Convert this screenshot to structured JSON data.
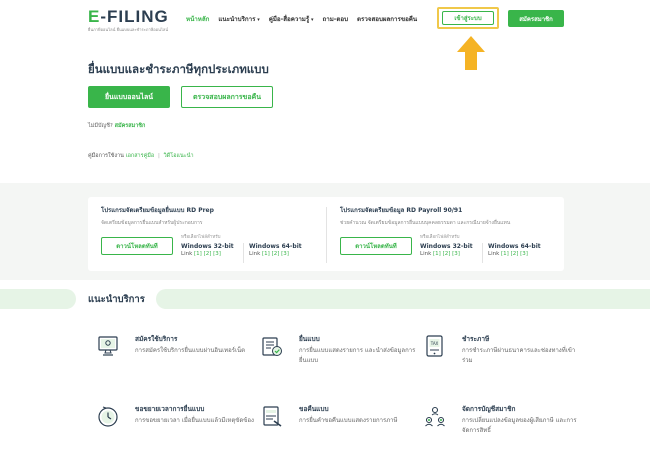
{
  "header": {
    "logo_text": "-FILING",
    "logo_letter": "E",
    "logo_subtitle": "ยื่นภาษีออนไลน์ ยื่นแบบและชำระภาษีออนไลน์",
    "nav": [
      {
        "label": "หน้าหลัก",
        "active": true
      },
      {
        "label": "แนะนำบริการ",
        "dropdown": true
      },
      {
        "label": "คู่มือ-สื่อความรู้",
        "dropdown": true
      },
      {
        "label": "ถาม-ตอบ"
      },
      {
        "label": "ตรวจสอบผลการขอคืน"
      }
    ],
    "login_label": "เข้าสู่ระบบ",
    "register_label": "สมัครสมาชิก"
  },
  "hero": {
    "title": "ยื่นแบบและชำระภาษีทุกประเภทแบบ",
    "online_button": "ยื่นแบบออนไลน์",
    "check_button": "ตรวจสอบผลการขอคืน",
    "no_account_text": "ไม่มีบัญชี?",
    "no_account_link": "สมัครสมาชิก",
    "guide_label": "คู่มือการใช้งาน",
    "guide_link_1": "เอกสารคู่มือ",
    "guide_link_2": "วิดีโอแนะนำ"
  },
  "downloads": [
    {
      "title": "โปรแกรมจัดเตรียมข้อมูลยื่นแบบ RD Prep",
      "description": "จัดเตรียมข้อมูลการยื่นแบบสำหรับผู้ประกอบการ",
      "button": "ดาวน์โหลดทันที",
      "or_text": "หรือเลือกไฟล์สำหรับ",
      "options": [
        {
          "name": "Windows 32-bit",
          "links_prefix": "Link",
          "links": [
            "[1]",
            "[2]",
            "[3]"
          ]
        },
        {
          "name": "Windows 64-bit",
          "links_prefix": "Link",
          "links": [
            "[1]",
            "[2]",
            "[3]"
          ]
        }
      ]
    },
    {
      "title": "โปรแกรมจัดเตรียมข้อมูล RD Payroll 90/91",
      "description": "ช่วยคำนวณ จัดเตรียมข้อมูลการยื่นแบบบุคคลธรรมดา และกรณีนายจ้างยื่นแทน",
      "button": "ดาวน์โหลดทันที",
      "or_text": "หรือเลือกไฟล์สำหรับ",
      "options": [
        {
          "name": "Windows 32-bit",
          "links_prefix": "Link",
          "links": [
            "[1]",
            "[2]",
            "[3]"
          ]
        },
        {
          "name": "Windows 64-bit",
          "links_prefix": "Link",
          "links": [
            "[1]",
            "[2]",
            "[3]"
          ]
        }
      ]
    }
  ],
  "services": {
    "title": "แนะนำบริการ",
    "items": [
      {
        "title": "สมัครใช้บริการ",
        "desc": "การสมัครใช้บริการยื่นแบบผ่านอินเทอร์เน็ต",
        "icon": "register-computer-icon"
      },
      {
        "title": "ยื่นแบบ",
        "desc": "การยื่นแบบแสดงรายการ และนำส่งข้อมูลการยื่นแบบ",
        "icon": "file-form-icon"
      },
      {
        "title": "ชำระภาษี",
        "desc": "การชำระภาษีผ่านธนาคารและช่องทางที่เข้าร่วม",
        "icon": "payment-tablet-icon"
      },
      {
        "title": "ขอขยายเวลาการยื่นแบบ",
        "desc": "การขอขยายเวลา เมื่อยื่นแบบแล้วมีเหตุขัดข้อง",
        "icon": "clock-extend-icon"
      },
      {
        "title": "ขอคืนแบบ",
        "desc": "การยื่นคำขอคืนแบบแสดงรายการภาษี",
        "icon": "refund-document-icon"
      },
      {
        "title": "จัดการบัญชีสมาชิก",
        "desc": "การเปลี่ยนแปลงข้อมูลของผู้เสียภาษี และการจัดการสิทธิ์",
        "icon": "account-users-icon"
      }
    ]
  },
  "colors": {
    "brand_green": "#39b54a",
    "highlight_yellow": "#f0c84a",
    "arrow_orange": "#f5b324",
    "dark_text": "#2c3e50"
  }
}
